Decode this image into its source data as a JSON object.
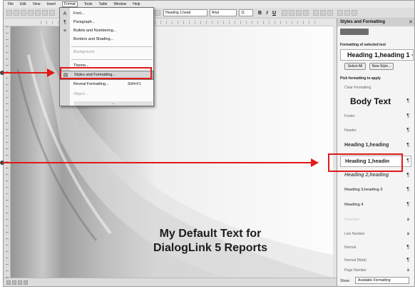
{
  "menubar": {
    "items": [
      "File",
      "Edit",
      "View",
      "Insert",
      "Format",
      "Tools",
      "Table",
      "Window",
      "Help"
    ]
  },
  "toolbar": {
    "style_box": "Heading 1,head",
    "font_box": "Arial",
    "size_box": "11",
    "bold": "B",
    "italic": "I",
    "underline": "U"
  },
  "format_menu": {
    "items": [
      {
        "label": "Font...",
        "icon": "font-icon"
      },
      {
        "label": "Paragraph...",
        "icon": "paragraph-icon"
      },
      {
        "label": "Bullets and Numbering...",
        "icon": "bullets-icon"
      },
      {
        "label": "Borders and Shading...",
        "icon": ""
      },
      {
        "label": "Background",
        "icon": "",
        "disabled": true
      },
      {
        "label": "Theme...",
        "icon": ""
      },
      {
        "label": "Styles and Formatting...",
        "icon": "styles-icon",
        "highlighted": true
      },
      {
        "label": "Reveal Formatting...",
        "shortcut": "Shift+F1",
        "icon": ""
      },
      {
        "label": "Object...",
        "icon": "",
        "disabled": true
      }
    ]
  },
  "document": {
    "line1": "My Default Text for",
    "line2": "DialogLink 5 Reports"
  },
  "task_pane": {
    "title": "Styles and Formatting",
    "formatting_of_selected": "Formatting of selected text",
    "selected_style": "Heading 1,heading 1 +",
    "select_all": "Select All",
    "new_style": "New Style...",
    "pick_formatting": "Pick formatting to apply",
    "styles": [
      {
        "name": "Clear Formatting",
        "mark": ""
      },
      {
        "name": "Body Text",
        "mark": "¶"
      },
      {
        "name": "Footer",
        "mark": "¶"
      },
      {
        "name": "Header",
        "mark": "¶"
      },
      {
        "name": "Heading 1,heading",
        "mark": "¶"
      },
      {
        "name": "Heading 1,headin",
        "mark": "¶"
      },
      {
        "name": "Heading 2,heading",
        "mark": "¶"
      },
      {
        "name": "Heading 3,heading 3",
        "mark": "¶"
      },
      {
        "name": "Heading 4",
        "mark": "¶"
      },
      {
        "name": "Hyperlink",
        "mark": "a"
      },
      {
        "name": "Line Number",
        "mark": "a"
      },
      {
        "name": "Normal",
        "mark": "¶"
      },
      {
        "name": "Normal (Web)",
        "mark": "¶"
      },
      {
        "name": "Page Number",
        "mark": "a"
      }
    ],
    "show_label": "Show:",
    "show_value": "Available Formatting"
  },
  "colors": {
    "annotation": "#e11a18"
  }
}
